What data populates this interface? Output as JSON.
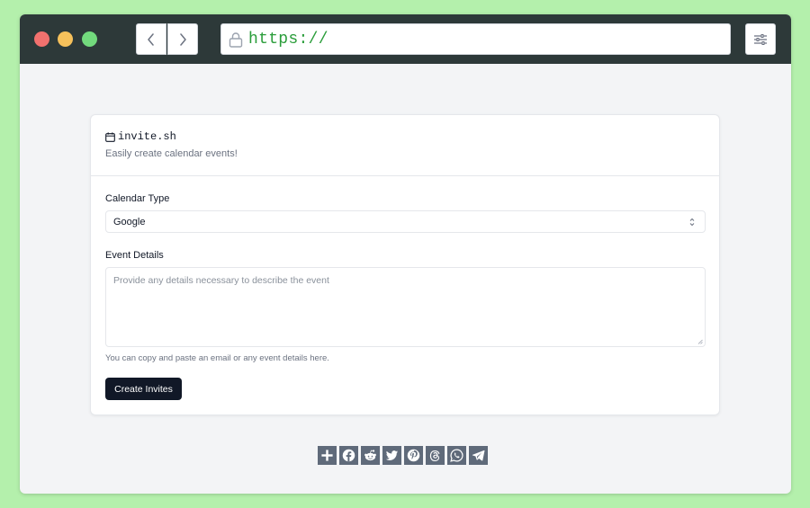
{
  "browser": {
    "url": "https://",
    "controls": [
      "close",
      "minimize",
      "maximize"
    ]
  },
  "app": {
    "name": "invite.sh",
    "tagline": "Easily create calendar events!"
  },
  "form": {
    "calendar_type_label": "Calendar Type",
    "calendar_type_value": "Google",
    "event_details_label": "Event Details",
    "event_details_placeholder": "Provide any details necessary to describe the event",
    "event_details_hint": "You can copy and paste an email or any event details here.",
    "submit_label": "Create Invites"
  },
  "share": {
    "icons": [
      "plus-icon",
      "facebook-icon",
      "reddit-icon",
      "twitter-icon",
      "pinterest-icon",
      "threads-icon",
      "whatsapp-icon",
      "telegram-icon"
    ]
  },
  "colors": {
    "page_background": "#b4f0ac",
    "titlebar": "#2d3939",
    "url_text": "#2a9d3a",
    "primary_button": "#111827",
    "share_icon_bg": "#5f6a7a"
  }
}
